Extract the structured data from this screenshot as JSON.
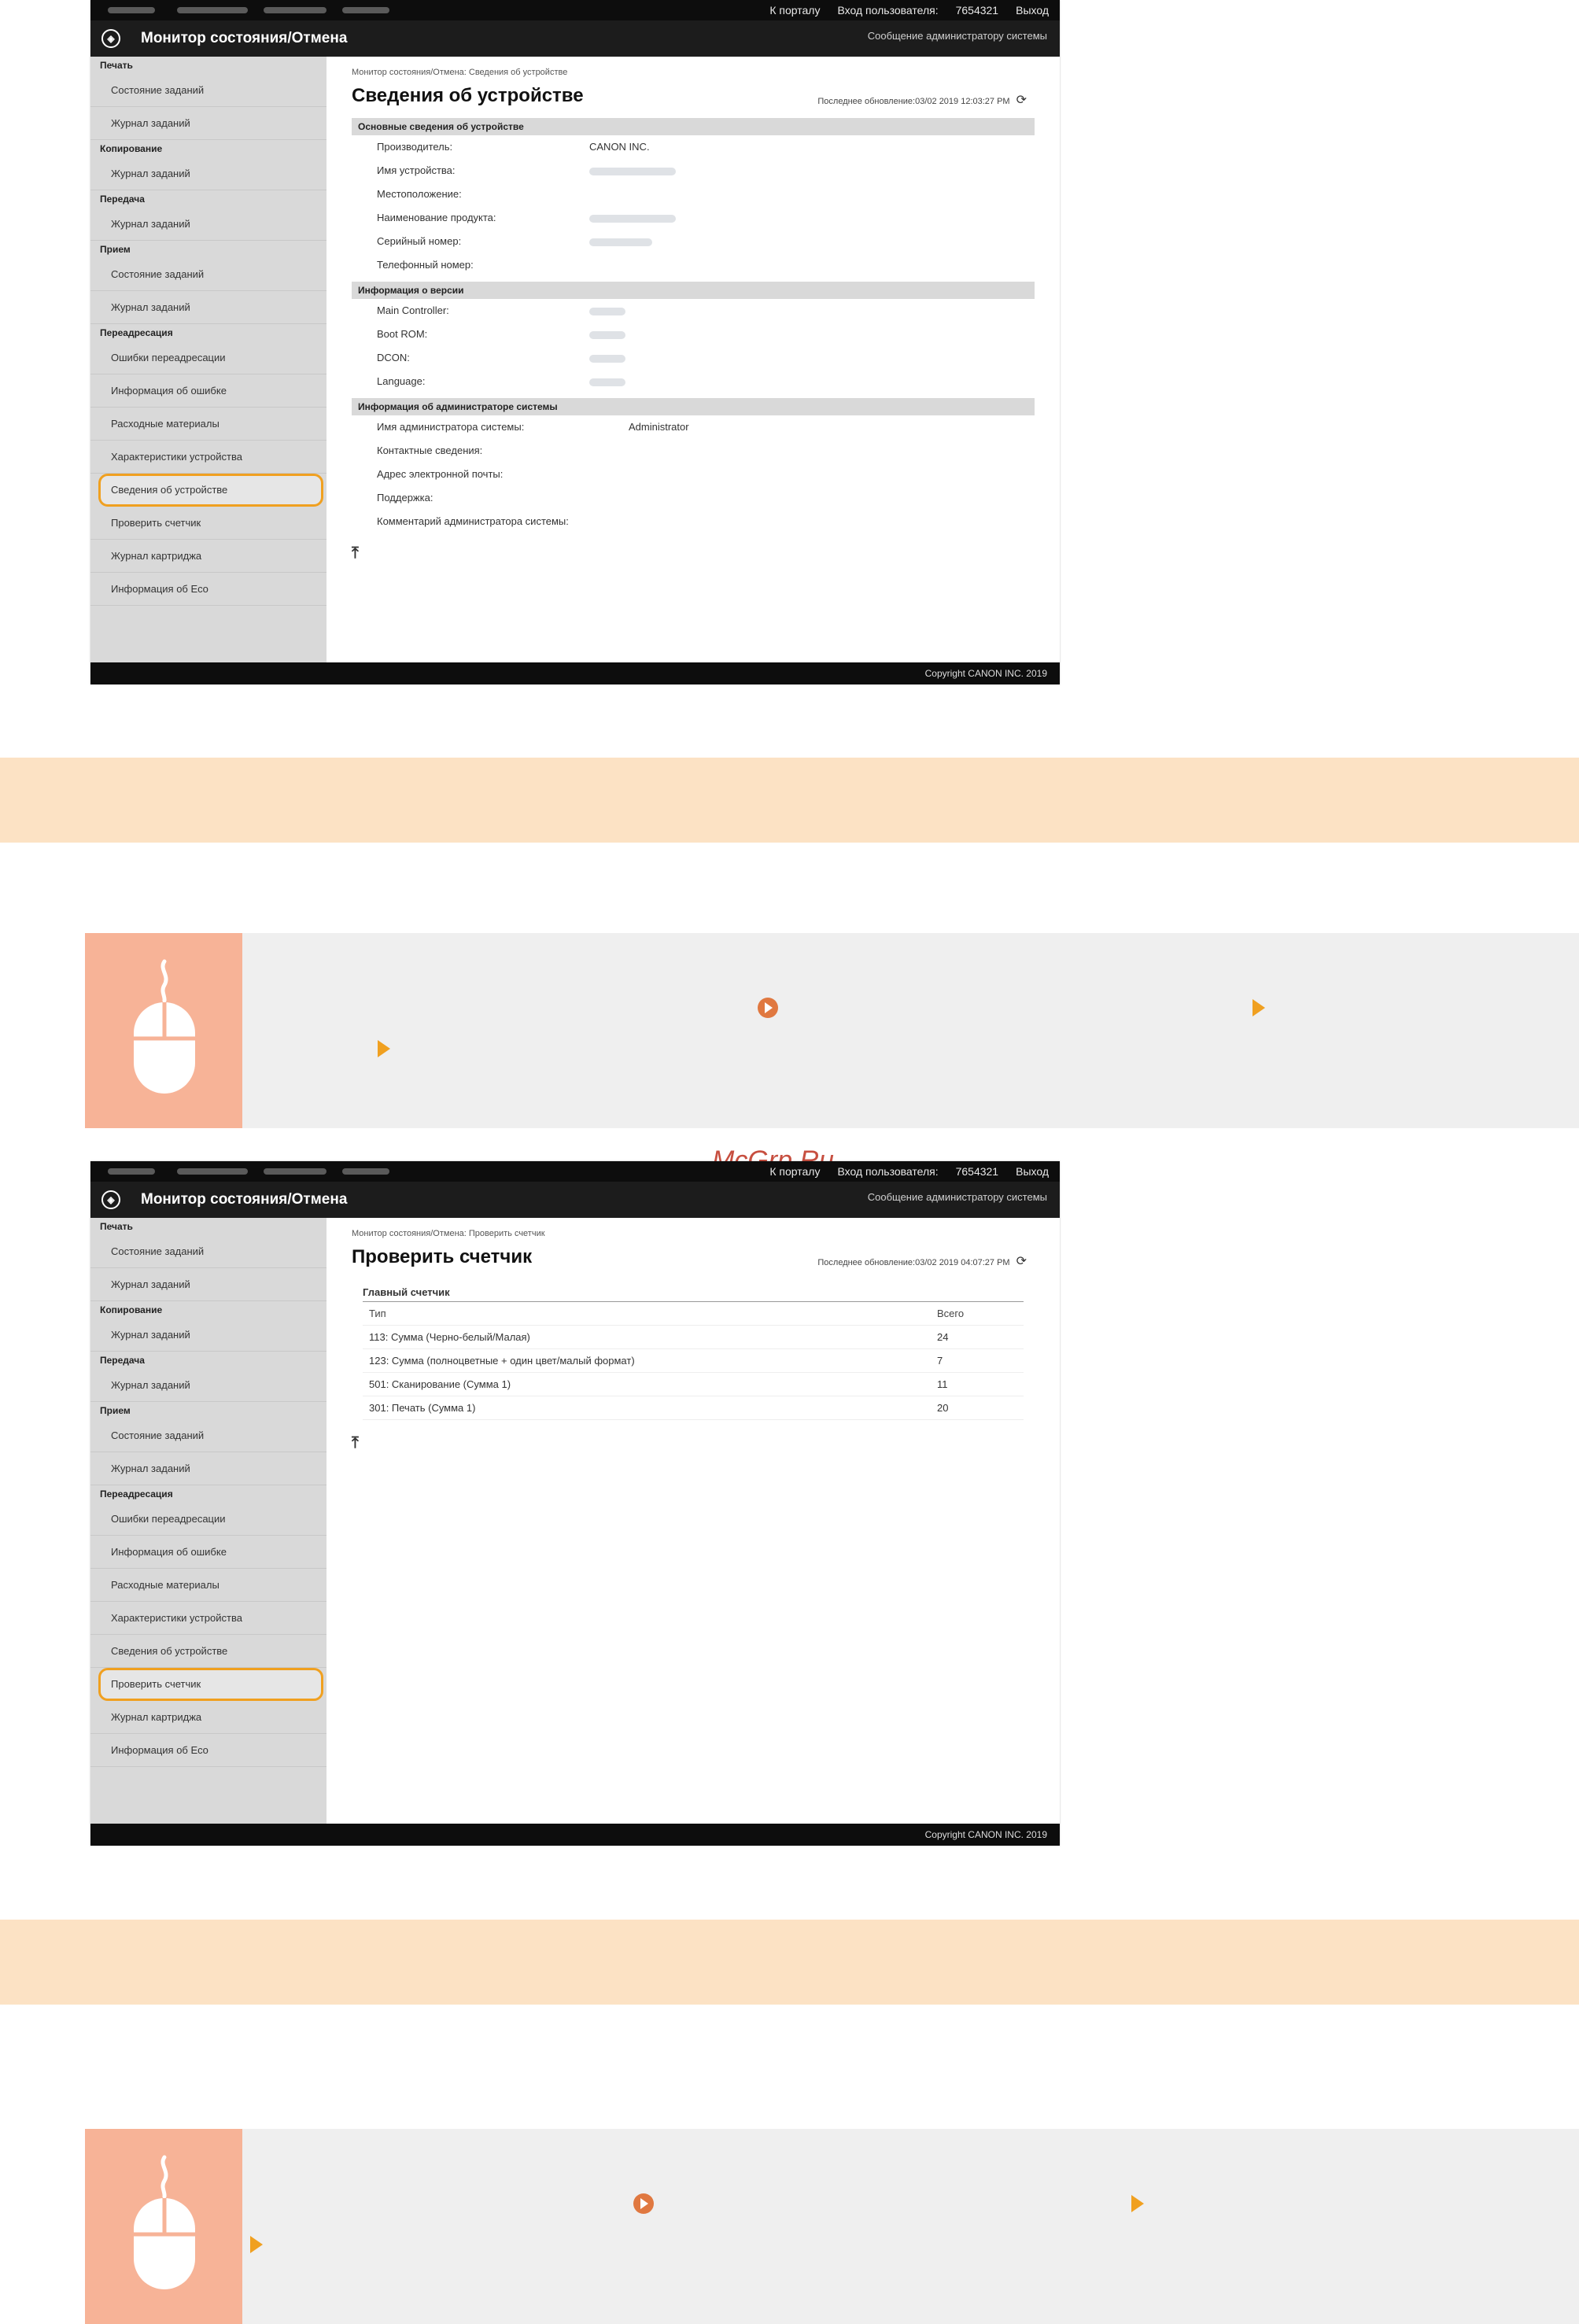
{
  "colors": {
    "highlight": "#f0a020",
    "band": "#fce2c4",
    "tip_icon_bg": "#f7b397",
    "top_bar": "#0d0d0d",
    "sidebar": "#d9d9d9"
  },
  "topbar": {
    "portal": "К порталу",
    "login_label": "Вход пользователя:",
    "user": "7654321",
    "logout": "Выход"
  },
  "app": {
    "title": "Монитор состояния/Отмена",
    "admin_message": "Сообщение администратору системы",
    "copyright": "Copyright CANON INC. 2019"
  },
  "sidebar": {
    "print": {
      "head": "Печать",
      "items": [
        "Состояние заданий",
        "Журнал заданий"
      ]
    },
    "copy": {
      "head": "Копирование",
      "items": [
        "Журнал заданий"
      ]
    },
    "send": {
      "head": "Передача",
      "items": [
        "Журнал заданий"
      ]
    },
    "receive": {
      "head": "Прием",
      "items": [
        "Состояние заданий",
        "Журнал заданий"
      ]
    },
    "forward": {
      "head": "Переадресация",
      "items": [
        "Ошибки переадресации"
      ]
    },
    "misc": [
      "Информация об ошибке",
      "Расходные материалы",
      "Характеристики устройства",
      "Сведения об устройстве",
      "Проверить счетчик",
      "Журнал картриджа",
      "Информация об Eco"
    ]
  },
  "shot1": {
    "breadcrumb": "Монитор состояния/Отмена: Сведения об устройстве",
    "title": "Сведения об устройстве",
    "last_updated": "Последнее обновление:03/02 2019 12:03:27 PM",
    "sec_basic": "Основные сведения об устройстве",
    "basic": [
      {
        "k": "Производитель:",
        "v": "CANON INC."
      },
      {
        "k": "Имя устройства:",
        "v": ""
      },
      {
        "k": "Местоположение:",
        "v": ""
      },
      {
        "k": "Наименование продукта:",
        "v": ""
      },
      {
        "k": "Серийный номер:",
        "v": ""
      },
      {
        "k": "Телефонный номер:",
        "v": ""
      }
    ],
    "sec_version": "Информация о версии",
    "version": [
      "Main Controller:",
      "Boot ROM:",
      "DCON:",
      "Language:"
    ],
    "sec_admin": "Информация об администраторе системы",
    "admin": [
      {
        "k": "Имя администратора системы:",
        "v": "Administrator"
      },
      {
        "k": "Контактные сведения:",
        "v": ""
      },
      {
        "k": "Адрес электронной почты:",
        "v": ""
      },
      {
        "k": "Поддержка:",
        "v": ""
      },
      {
        "k": "Комментарий администратора системы:",
        "v": ""
      }
    ]
  },
  "shot2": {
    "breadcrumb": "Монитор состояния/Отмена: Проверить счетчик",
    "title": "Проверить счетчик",
    "last_updated": "Последнее обновление:03/02 2019 04:07:27 PM",
    "counter_title": "Главный счетчик",
    "col_type": "Тип",
    "col_total": "Всего",
    "rows": [
      {
        "type": "113: Сумма (Черно-белый/Малая)",
        "total": "24"
      },
      {
        "type": "123: Сумма (полноцветные + один цвет/малый формат)",
        "total": "7"
      },
      {
        "type": "501: Сканирование (Сумма 1)",
        "total": "11"
      },
      {
        "type": "301: Печать (Сумма 1)",
        "total": "20"
      }
    ]
  },
  "watermark": "McGrp.Ru"
}
